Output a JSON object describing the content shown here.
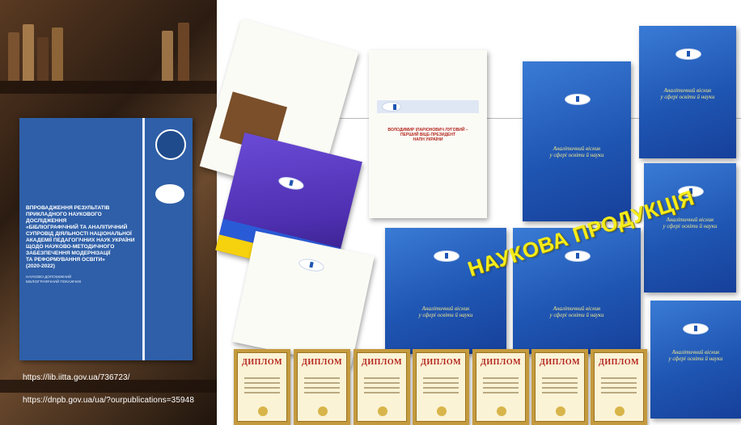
{
  "left_panel": {
    "cover": {
      "title": "ВПРОВАДЖЕННЯ РЕЗУЛЬТАТІВ\nПРИКЛАДНОГО НАУКОВОГО ДОСЛІДЖЕННЯ\n«БІБЛІОГРАФІЧНИЙ ТА АНАЛІТИЧНИЙ\nСУПРОВІД ДІЯЛЬНОСТІ НАЦІОНАЛЬНОЇ\nАКАДЕМІЇ ПЕДАГОГІЧНИХ НАУК УКРАЇНИ\nЩОДО НАУКОВО-МЕТОДИЧНОГО\nЗАБЕЗПЕЧЕННЯ МОДЕРНІЗАЦІЇ\nТА РЕФОРМУВАННЯ ОСВІТИ»\n(2020-2022)",
      "subtitle": "НАУКОВО-ДОПОМІЖНИЙ\nБІБЛІОГРАФІЧНИЙ ПОКАЖЧИК"
    },
    "links": [
      "https://lib.iitta.gov.ua/736723/",
      "https://dnpb.gov.ua/ua/?ourpublications=35948"
    ]
  },
  "collage": {
    "stamp_text": "НАУКОВА ПРОДУКЦІЯ",
    "center_doc_title": "ВОЛОДИМИР ІЛАРІОНОВИЧ ЛУГОВИЙ –\nПЕРШИЙ ВІЦЕ-ПРЕЗИДЕНТ\nНАПН УКРАЇНИ",
    "bulletin_title": "Аналітичний вісник\nу сфері освіти й науки",
    "diploma_label": "ДИПЛОМ",
    "diploma_count": 7
  },
  "colors": {
    "cover_blue": "#2e5fa8",
    "bulletin_blue": "#1f56b3",
    "stamp_yellow": "#f4ec1c",
    "diploma_red": "#b3261e"
  }
}
